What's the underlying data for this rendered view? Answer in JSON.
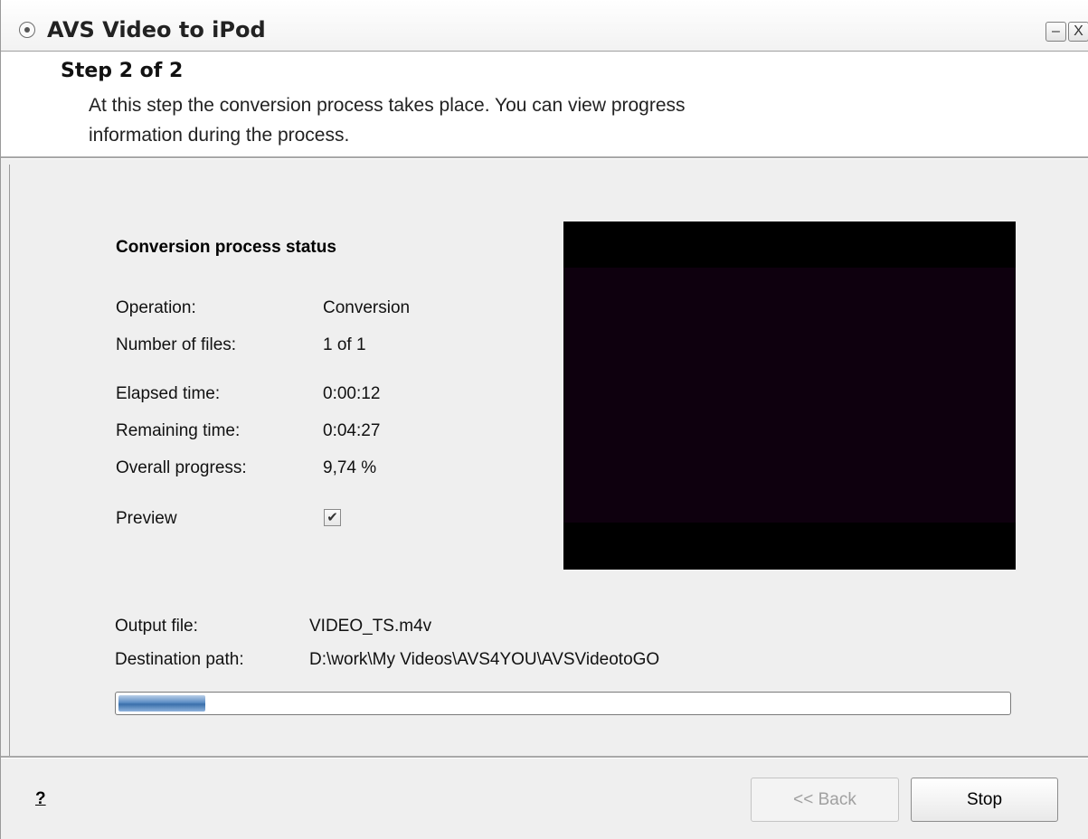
{
  "window": {
    "title": "AVS Video to iPod",
    "minimize_label": "–",
    "close_label": "X"
  },
  "header": {
    "step": "Step 2 of 2",
    "description_line1": "At this step the conversion process takes place. You can view progress",
    "description_line2": "information during the process."
  },
  "status": {
    "heading": "Conversion process status",
    "rows": [
      {
        "label": "Operation:",
        "value": "Conversion"
      },
      {
        "label": "Number of files:",
        "value": "1 of 1"
      },
      {
        "label": "Elapsed time:",
        "value": "0:00:12"
      },
      {
        "label": "Remaining time:",
        "value": "0:04:27"
      },
      {
        "label": "Overall progress:",
        "value": "9,74 %"
      }
    ],
    "preview_label": "Preview",
    "preview_checked": true,
    "checkmark": "✔"
  },
  "output": {
    "file_label": "Output file:",
    "file_value": "VIDEO_TS.m4v",
    "path_label": "Destination path:",
    "path_value": "D:\\work\\My Videos\\AVS4YOU\\AVSVideotoGO"
  },
  "progress": {
    "fraction": 0.0974
  },
  "footer": {
    "help": "?",
    "back_label": "<< Back",
    "stop_label": "Stop"
  },
  "colors": {
    "progress_fill": "#3a6faa",
    "preview_bg": "#0e000e"
  },
  "icons": {
    "system_menu": "system-menu-icon",
    "checkbox": "checkmark-icon"
  }
}
